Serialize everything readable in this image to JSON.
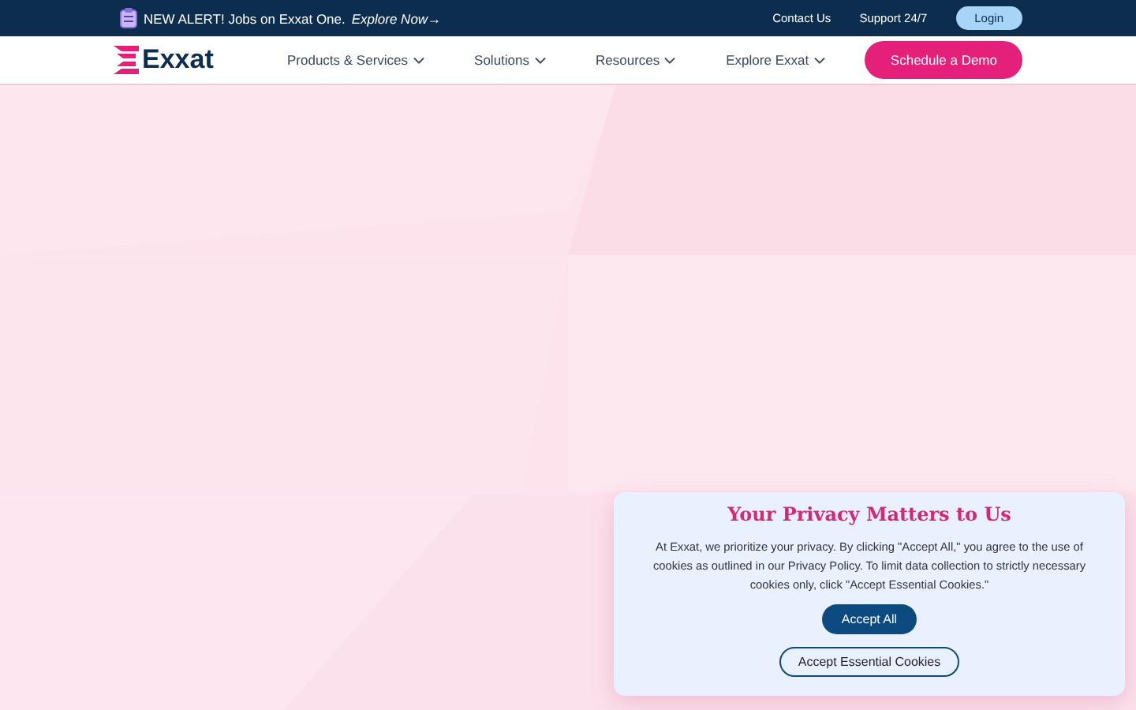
{
  "alert_bar": {
    "text": "NEW ALERT! Jobs on Exxat One.",
    "link": "Explore Now→",
    "links": [
      "Contact Us",
      "Support 24/7"
    ],
    "login": "Login"
  },
  "nav": {
    "logo": "Exxat",
    "items": [
      {
        "label": "Products & Services"
      },
      {
        "label": "Solutions"
      },
      {
        "label": "Resources"
      },
      {
        "label": "Explore Exxat"
      }
    ],
    "cta": "Schedule a Demo"
  },
  "cookie_banner": {
    "title": "Your Privacy Matters to Us",
    "body": "At Exxat, we prioritize your privacy. By clicking \"Accept All,\" you agree to the use of cookies as outlined in our Privacy Policy. To limit data collection to strictly necessary cookies only, click \"Accept Essential Cookies.\"",
    "accept": "Accept All",
    "essential": "Accept Essential Cookies"
  }
}
